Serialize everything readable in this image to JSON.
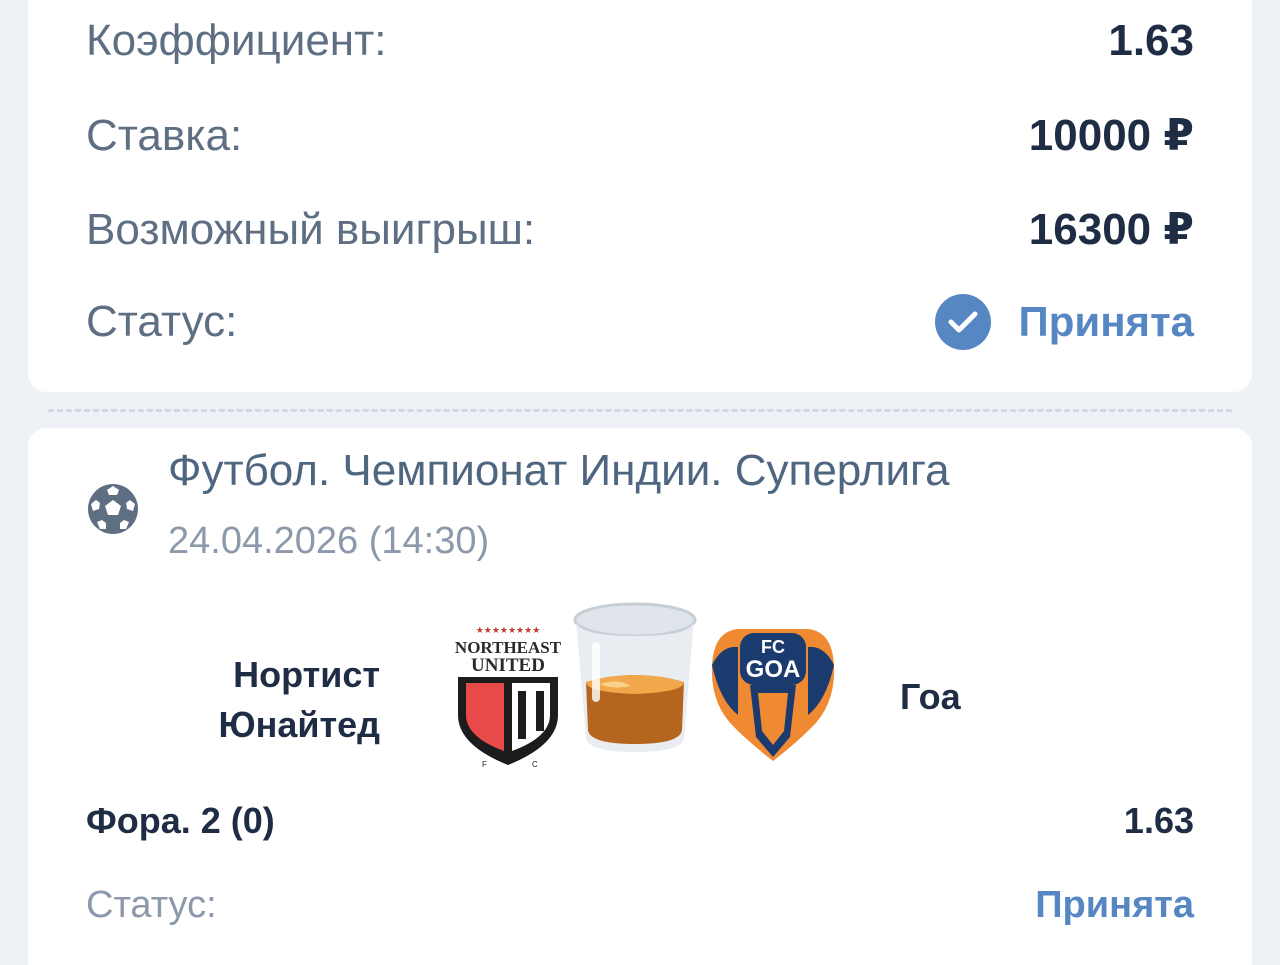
{
  "summary": {
    "coefficient_label": "Коэффициент:",
    "coefficient_value": "1.63",
    "stake_label": "Ставка:",
    "stake_value": "10000 ₽",
    "potential_win_label": "Возможный выигрыш:",
    "potential_win_value": "16300 ₽",
    "status_label": "Статус:",
    "status_value": "Принята"
  },
  "event": {
    "league": "Футбол. Чемпионат Индии. Суперлига",
    "datetime": "24.04.2026 (14:30)",
    "sport_icon": "soccer-ball-icon",
    "home_team_line1": "Нортист",
    "home_team_line2": "Юнайтед",
    "away_team": "Гоа",
    "home_logo_text_top": "NORTHEAST",
    "home_logo_text_mid": "UNITED",
    "away_logo_text_top": "FC",
    "away_logo_text_mid": "GOA",
    "bet_name": "Фора. 2 (0)",
    "bet_coefficient": "1.63",
    "status_label": "Статус:",
    "status_value": "Принята"
  },
  "colors": {
    "accent": "#5687c3",
    "text_dark": "#1f2d44",
    "text_muted": "#5e6f84"
  }
}
